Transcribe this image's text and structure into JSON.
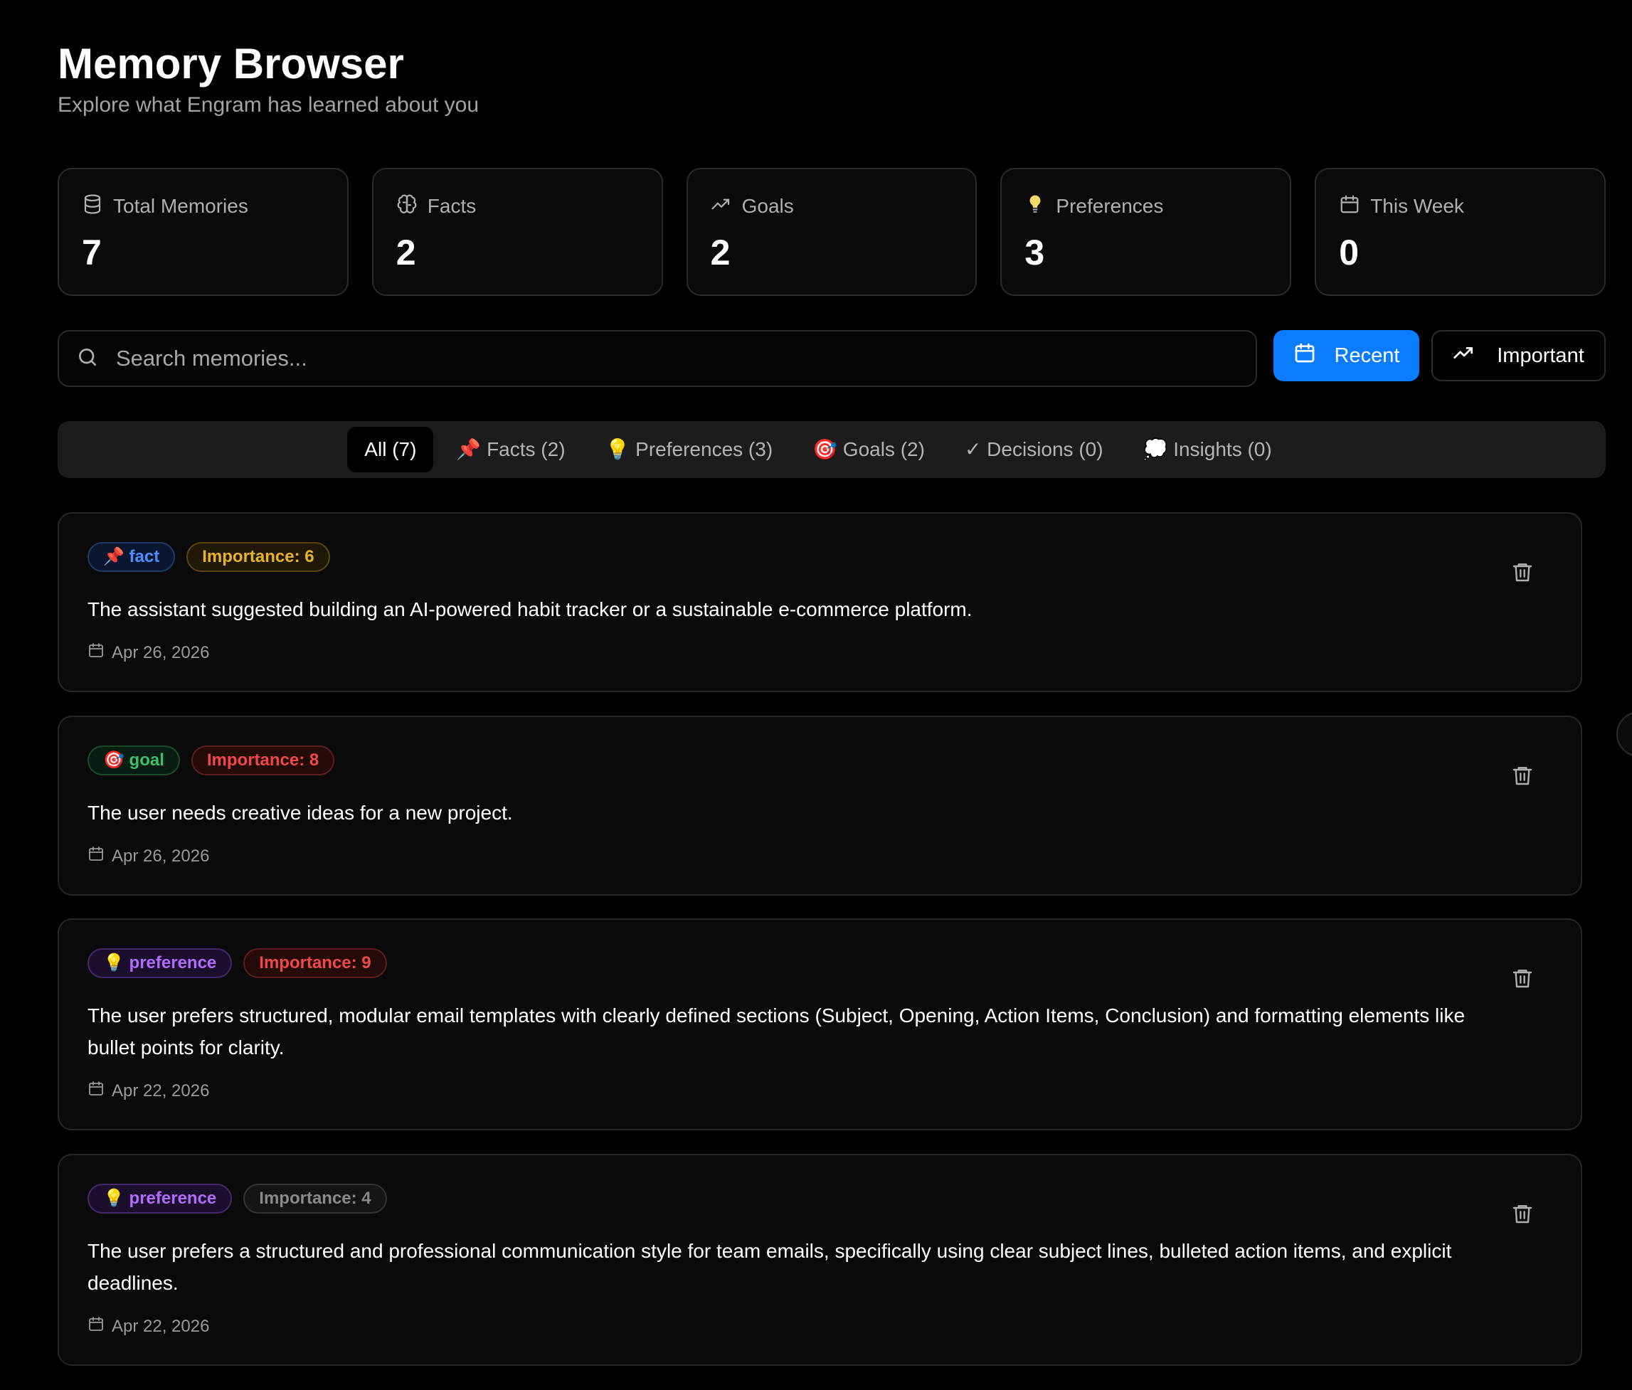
{
  "header": {
    "title": "Memory Browser",
    "subtitle": "Explore what Engram has learned about you"
  },
  "stats": [
    {
      "label": "Total Memories",
      "value": "7",
      "icon": "database-icon"
    },
    {
      "label": "Facts",
      "value": "2",
      "icon": "brain-icon"
    },
    {
      "label": "Goals",
      "value": "2",
      "icon": "trending-up-icon"
    },
    {
      "label": "Preferences",
      "value": "3",
      "icon": "lightbulb-icon"
    },
    {
      "label": "This Week",
      "value": "0",
      "icon": "calendar-icon"
    }
  ],
  "search": {
    "placeholder": "Search memories..."
  },
  "sort": {
    "recent_label": "Recent",
    "important_label": "Important",
    "active": "Recent"
  },
  "tabs": [
    {
      "label": "All (7)",
      "active": true
    },
    {
      "label": "📌 Facts (2)",
      "active": false
    },
    {
      "label": "💡 Preferences (3)",
      "active": false
    },
    {
      "label": "🎯 Goals (2)",
      "active": false
    },
    {
      "label": "✓ Decisions (0)",
      "active": false
    },
    {
      "label": "💭 Insights (0)",
      "active": false
    }
  ],
  "memories": [
    {
      "type_label": "📌 fact",
      "importance_label": "Importance: 6",
      "text": "The assistant suggested building an AI-powered habit tracker or a sustainable e-commerce platform.",
      "date": "Apr 26, 2026"
    },
    {
      "type_label": "🎯 goal",
      "importance_label": "Importance: 8",
      "text": "The user needs creative ideas for a new project.",
      "date": "Apr 26, 2026"
    },
    {
      "type_label": "💡 preference",
      "importance_label": "Importance: 9",
      "text": "The user prefers structured, modular email templates with clearly defined sections (Subject, Opening, Action Items, Conclusion) and formatting elements like bullet points for clarity.",
      "date": "Apr 22, 2026"
    },
    {
      "type_label": "💡 preference",
      "importance_label": "Importance: 4",
      "text": "The user prefers a structured and professional communication style for team emails, specifically using clear subject lines, bulleted action items, and explicit deadlines.",
      "date": "Apr 22, 2026"
    }
  ],
  "colors": {
    "accent": "#0a7cff",
    "background": "#000000",
    "fact": "#4e8dff",
    "goal": "#3fbf6a",
    "preference": "#b26bff",
    "importance_mid": "#e8b422",
    "importance_high": "#f04848",
    "importance_low": "#8a8a8a"
  }
}
